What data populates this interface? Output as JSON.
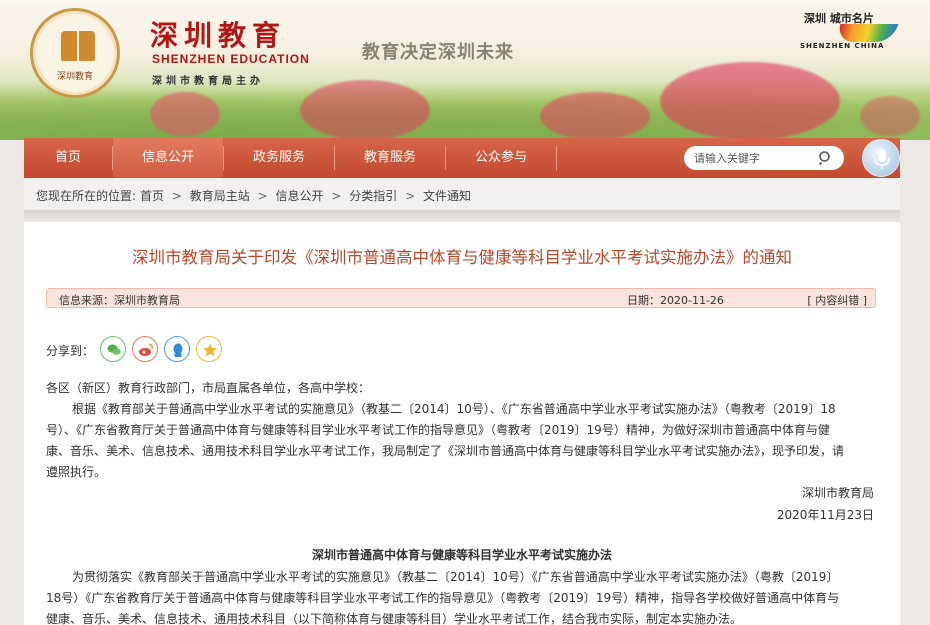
{
  "header": {
    "seal_text": "深圳教育",
    "title_cn": "深圳教育",
    "title_en": "SHENZHEN EDUCATION",
    "subtitle": "深圳市教育局主办",
    "slogan": "教育决定深圳未来",
    "sz_logo_cn": "深圳 城市名片",
    "sz_logo_en": "SHENZHEN CHINA"
  },
  "nav": {
    "items": [
      {
        "label": "首页"
      },
      {
        "label": "信息公开"
      },
      {
        "label": "政务服务"
      },
      {
        "label": "教育服务"
      },
      {
        "label": "公众参与"
      }
    ],
    "active_index": 1,
    "search_placeholder": "请输入关键字"
  },
  "breadcrumb": {
    "prefix": "您现在所在的位置:",
    "items": [
      "首页",
      "教育局主站",
      "信息公开",
      "分类指引",
      "文件通知"
    ],
    "separator": ">"
  },
  "article": {
    "title": "深圳市教育局关于印发《深圳市普通高中体育与健康等科目学业水平考试实施办法》的通知",
    "source_label": "信息来源：",
    "source": "深圳市教育局",
    "date_label": "日期：",
    "date": "2020-11-26",
    "error_link": "[ 内容纠错 ]",
    "share_label": "分享到：",
    "share_icons": [
      "wechat-icon",
      "weibo-icon",
      "qq-icon",
      "favorite-icon"
    ],
    "salutation": "各区（新区）教育行政部门，市局直属各单位，各高中学校：",
    "para1_line1": "根据《教育部关于普通高中学业水平考试的实施意见》（教基二〔2014〕10号）、《广东省普通高中学业水平考试实施办法》（粤教考〔2019〕18",
    "para1_line2": "号）、《广东省教育厅关于普通高中体育与健康等科目学业水平考试工作的指导意见》（粤教考〔2019〕19号）精神，为做好深圳市普通高中体育与健",
    "para1_line3": "康、音乐、美术、信息技术、通用技术科目学业水平考试工作，我局制定了《深圳市普通高中体育与健康等科目学业水平考试实施办法》，现予印发，请",
    "para1_line4": "遵照执行。",
    "signature": "深圳市教育局",
    "sign_date": "2020年11月23日",
    "sub_title": "深圳市普通高中体育与健康等科目学业水平考试实施办法",
    "para2_line1": "为贯彻落实《教育部关于普通高中学业水平考试的实施意见》（教基二〔2014〕10号）《广东省普通高中学业水平考试实施办法》（粤教〔2019〕",
    "para2_line2": "18号）《广东省教育厅关于普通高中体育与健康等科目学业水平考试工作的指导意见》（粤教考〔2019〕19号）精神，指导各学校做好普通高中体育与",
    "para2_line3": "健康、音乐、美术、信息技术、通用技术科目（以下简称体育与健康等科目）学业水平考试工作，结合我市实际，制定本实施办法。"
  },
  "colors": {
    "nav_bg": "#c24a30",
    "title_color": "#b34a2c",
    "info_bar_bg": "#fbe3de"
  }
}
